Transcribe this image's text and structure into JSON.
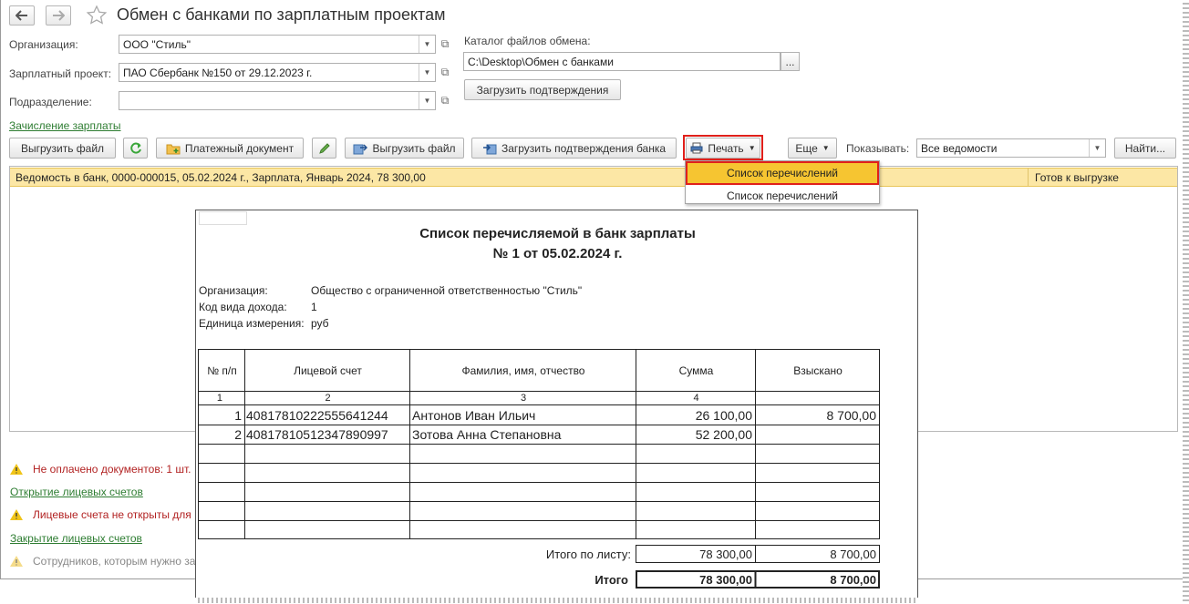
{
  "header": {
    "title": "Обмен с банками по зарплатным проектам",
    "back_icon": "arrow-left-icon",
    "forward_icon": "arrow-right-icon",
    "favorite_icon": "star-icon"
  },
  "form": {
    "org_label": "Организация:",
    "org_value": "ООО \"Стиль\"",
    "project_label": "Зарплатный проект:",
    "project_value": "ПАО Сбербанк №150 от 29.12.2023 г.",
    "division_label": "Подразделение:",
    "division_value": "",
    "catalog_label": "Каталог файлов обмена:",
    "catalog_value": "C:\\Desktop\\Обмен с банками",
    "catalog_button": "...",
    "load_confirm_button": "Загрузить подтверждения"
  },
  "section_link": "Зачисление зарплаты",
  "toolbar": {
    "export_file": "Выгрузить файл",
    "payment_doc": "Платежный документ",
    "export_file2": "Выгрузить файл",
    "load_bank_confirm": "Загрузить подтверждения банка",
    "print": "Печать",
    "more": "Еще",
    "show_label": "Показывать:",
    "show_value": "Все ведомости",
    "find": "Найти..."
  },
  "list": {
    "rows": [
      {
        "doc": "Ведомость в банк, 0000-000015, 05.02.2024 г., Зарплата, Январь 2024, 78 300,00",
        "status": "Готов к выгрузке"
      }
    ]
  },
  "print_menu": {
    "items": [
      "Список перечислений",
      "Список перечислений"
    ]
  },
  "messages": {
    "unpaid": "Не оплачено документов: 1 шт.",
    "open_accounts_link": "Открытие лицевых счетов",
    "accounts_not_open": "Лицевые счета не открыты для",
    "close_accounts_link": "Закрытие лицевых счетов",
    "employees_need": "Сотрудников, которым нужно за"
  },
  "report": {
    "title1": "Список перечисляемой в банк зарплаты",
    "title2": "№  1 от 05.02.2024 г.",
    "org_label": "Организация:",
    "org_value": "Общество с ограниченной ответственностью \"Стиль\"",
    "income_label": "Код вида дохода:",
    "income_value": "1",
    "unit_label": "Единица измерения:",
    "unit_value": "руб",
    "columns": [
      "№ п/п",
      "Лицевой счет",
      "Фамилия, имя, отчество",
      "Сумма",
      "Взыскано"
    ],
    "col_numbers": [
      "1",
      "2",
      "3",
      "4"
    ],
    "rows": [
      {
        "n": "1",
        "account": "40817810222555641244",
        "name": "Антонов Иван Ильич",
        "sum": "26 100,00",
        "withheld": "8 700,00"
      },
      {
        "n": "2",
        "account": "40817810512347890997",
        "name": "Зотова Анна Степановна",
        "sum": "52 200,00",
        "withheld": ""
      }
    ],
    "page_total_label": "Итого по листу:",
    "page_total_sum": "78 300,00",
    "page_total_withheld": "8 700,00",
    "total_label": "Итого",
    "total_sum": "78 300,00",
    "total_withheld": "8 700,00"
  },
  "colors": {
    "link": "#2e7d32",
    "highlight": "#fce7a5",
    "error_text": "#b22222",
    "callout_red": "#e0201b",
    "menu_hover": "#f6c531"
  }
}
